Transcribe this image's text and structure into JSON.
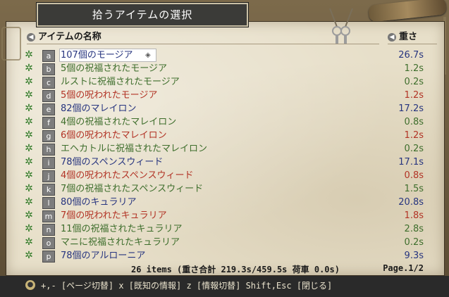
{
  "window": {
    "title": "拾うアイテムの選択"
  },
  "headers": {
    "name": "アイテムの名称",
    "weight": "重さ"
  },
  "items": [
    {
      "key": "a",
      "name": "107個のモージア",
      "weight": "26.7s",
      "color": "blue"
    },
    {
      "key": "b",
      "name": "5個の祝福されたモージア",
      "weight": "1.2s",
      "color": "green"
    },
    {
      "key": "c",
      "name": "ルストに祝福されたモージア",
      "weight": "0.2s",
      "color": "green"
    },
    {
      "key": "d",
      "name": "5個の呪われたモージア",
      "weight": "1.2s",
      "color": "red"
    },
    {
      "key": "e",
      "name": "82個のマレイロン",
      "weight": "17.2s",
      "color": "blue"
    },
    {
      "key": "f",
      "name": "4個の祝福されたマレイロン",
      "weight": "0.8s",
      "color": "green"
    },
    {
      "key": "g",
      "name": "6個の呪われたマレイロン",
      "weight": "1.2s",
      "color": "red"
    },
    {
      "key": "h",
      "name": "エヘカトルに祝福されたマレイロン",
      "weight": "0.2s",
      "color": "green"
    },
    {
      "key": "i",
      "name": "78個のスペンスウィード",
      "weight": "17.1s",
      "color": "blue"
    },
    {
      "key": "j",
      "name": "4個の呪われたスペンスウィード",
      "weight": "0.8s",
      "color": "red"
    },
    {
      "key": "k",
      "name": "7個の祝福されたスペンスウィード",
      "weight": "1.5s",
      "color": "green"
    },
    {
      "key": "l",
      "name": "80個のキュラリア",
      "weight": "20.8s",
      "color": "blue"
    },
    {
      "key": "m",
      "name": "7個の呪われたキュラリア",
      "weight": "1.8s",
      "color": "red"
    },
    {
      "key": "n",
      "name": "11個の祝福されたキュラリア",
      "weight": "2.8s",
      "color": "green"
    },
    {
      "key": "o",
      "name": "マニに祝福されたキュラリア",
      "weight": "0.2s",
      "color": "green"
    },
    {
      "key": "p",
      "name": "78個のアルローニア",
      "weight": "9.3s",
      "color": "blue"
    }
  ],
  "summary": {
    "text": "26 items  (重さ合計 219.3s/459.5s  荷車 0.0s)",
    "page": "Page.1/2"
  },
  "footer": {
    "hint": "+,- [ページ切替]  x [既知の情報]  z [情報切替]  Shift,Esc [閉じる]"
  },
  "colors": {
    "blue": "#27357f",
    "green": "#3e6e2c",
    "red": "#b23325",
    "title_bg": "#3b3b38"
  }
}
